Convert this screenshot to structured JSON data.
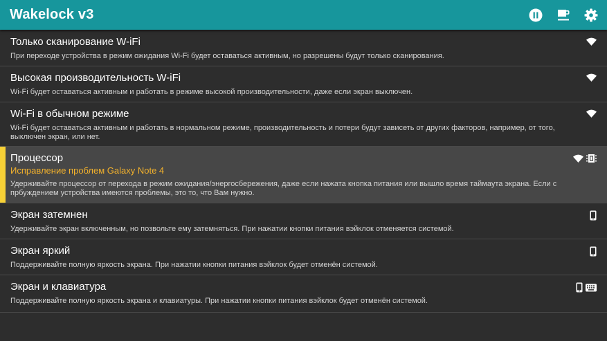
{
  "app": {
    "title": "Wakelock v3",
    "actions": [
      {
        "icon": "pause-icon"
      },
      {
        "icon": "coffee-icon"
      },
      {
        "icon": "gear-icon"
      }
    ]
  },
  "colors": {
    "toolbar": "#17969c",
    "background": "#2d2d2d",
    "selected_bg": "#474747",
    "selected_bar": "#f7d136",
    "subtitle": "#f2b12c"
  },
  "items": [
    {
      "title": "Только сканирование W-iFi",
      "desc": "При переходе устройства в режим ожидания Wi-Fi будет оставаться активным, но разрешены будут только сканирования.",
      "icons": [
        "wifi-icon"
      ]
    },
    {
      "title": "Высокая производительность W-iFi",
      "desc": "Wi-Fi будет оставаться активным и работать в режиме высокой производительности, даже если экран выключен.",
      "icons": [
        "wifi-icon"
      ]
    },
    {
      "title": "Wi-Fi в обычном режиме",
      "desc": "Wi-Fi будет оставаться активным и работать в нормальном режиме, производительность и потери будут зависеть от других факторов, например, от того, выключен экран, или нет.",
      "icons": [
        "wifi-icon"
      ]
    },
    {
      "title": "Процессор",
      "subtitle": "Исправление проблем Galaxy Note 4",
      "desc": "Удерживайте процессор от перехода в режим ожидания/энергосбережения, даже если нажата кнопка питания или вышло время таймаута экрана. Если с прбуждением устройства имеются проблемы, это то, что Вам нужно.",
      "icons": [
        "wifi-icon",
        "cpu-icon"
      ],
      "selected": true
    },
    {
      "title": "Экран затемнен",
      "desc": "Удерживайте экран включенным, но позвольте ему затемняться. При нажатии кнопки питания вэйклок отменяется системой.",
      "icons": [
        "phone-icon"
      ]
    },
    {
      "title": "Экран яркий",
      "desc": "Поддерживайте полную яркость экрана. При нажатии кнопки питания вэйклок будет отменён системой.",
      "icons": [
        "phone-icon"
      ]
    },
    {
      "title": "Экран и клавиатура",
      "desc": "Поддерживайте полную яркость экрана и клавиатуры. При нажатии кнопки питания вэйклок будет отменён системой.",
      "icons": [
        "phone-icon",
        "keyboard-icon"
      ]
    }
  ]
}
